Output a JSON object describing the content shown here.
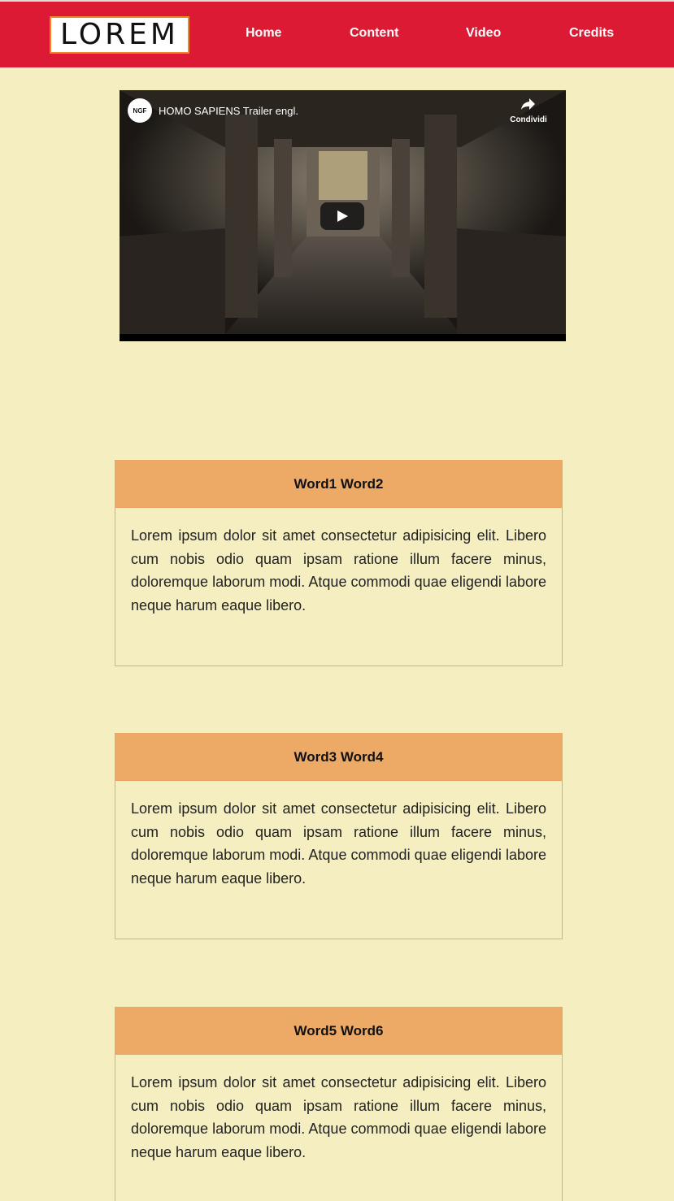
{
  "header": {
    "logo_text": "LOREM",
    "nav": [
      "Home",
      "Content",
      "Video",
      "Credits"
    ]
  },
  "video": {
    "channel_badge": "NGF",
    "title": "HOMO SAPIENS Trailer engl.",
    "share_label": "Condividi"
  },
  "cards": [
    {
      "title": "Word1 Word2",
      "body": "Lorem ipsum dolor sit amet consectetur adipisicing elit. Libero cum nobis odio quam ipsam ratione illum facere minus, doloremque laborum modi. Atque commodi quae eligendi labore neque harum eaque libero."
    },
    {
      "title": "Word3 Word4",
      "body": "Lorem ipsum dolor sit amet consectetur adipisicing elit. Libero cum nobis odio quam ipsam ratione illum facere minus, doloremque laborum modi. Atque commodi quae eligendi labore neque harum eaque libero."
    },
    {
      "title": "Word5 Word6",
      "body": "Lorem ipsum dolor sit amet consectetur adipisicing elit. Libero cum nobis odio quam ipsam ratione illum facere minus, doloremque laborum modi. Atque commodi quae eligendi labore neque harum eaque libero."
    }
  ],
  "colors": {
    "header_bg": "#dc1a34",
    "page_bg": "#f4eec1",
    "card_header_bg": "#eda966",
    "logo_border": "#f0872a"
  }
}
